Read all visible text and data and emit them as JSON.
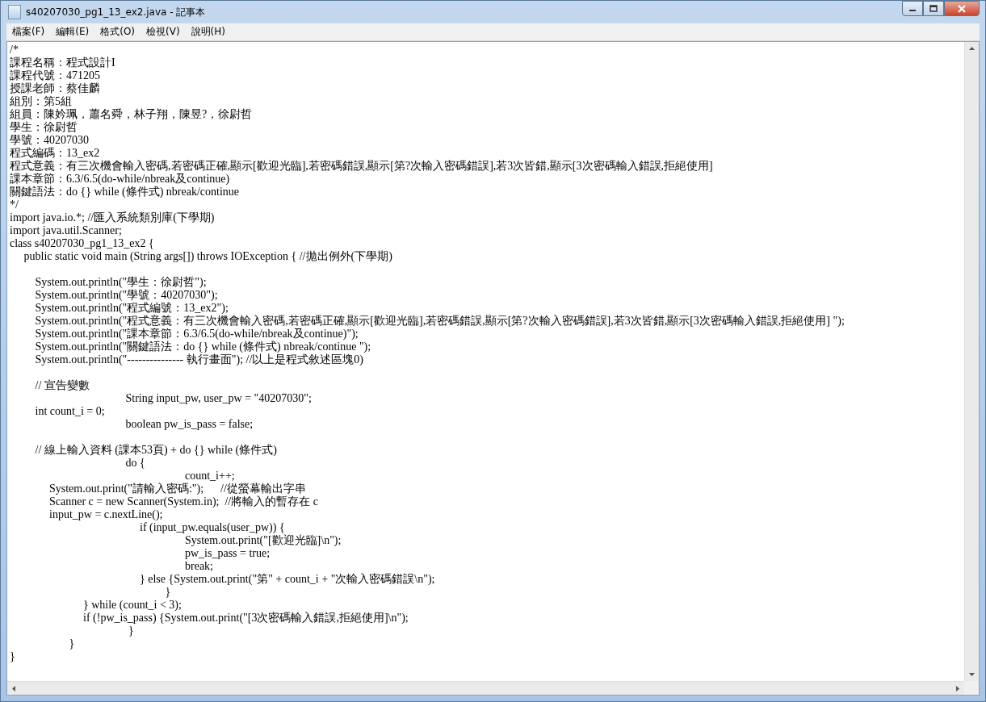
{
  "window": {
    "title": "s40207030_pg1_13_ex2.java - 記事本"
  },
  "menu": [
    {
      "label": "檔案(F)"
    },
    {
      "label": "編輯(E)"
    },
    {
      "label": "格式(O)"
    },
    {
      "label": "檢視(V)"
    },
    {
      "label": "說明(H)"
    }
  ],
  "editor": {
    "blocks": [
      [
        "/*",
        "課程名稱：程式設計I",
        "課程代號：471205",
        "授課老師：蔡佳麟",
        "組別：第5組",
        "組員：陳妗珮，蕭名舜，林子翔，陳昱?，徐尉哲",
        "學生：徐尉哲",
        "學號：40207030",
        "程式編碼：13_ex2",
        "程式意義：有三次機會輸入密碼,若密碼正確,顯示[歡迎光臨],若密碼錯誤,顯示[第?次輸入密碼錯誤],若3次皆錯,顯示[3次密碼輸入錯誤,拒絕使用]",
        "課本章節：6.3/6.5(do-while/nbreak及continue)",
        "關鍵語法：do {} while (條件式) nbreak/continue",
        "*/",
        "import java.io.*; //匯入系統類別庫(下學期)",
        "import java.util.Scanner;",
        "class s40207030_pg1_13_ex2 {",
        "     public static void main (String args[]) throws IOException { //拋出例外(下學期)"
      ],
      [
        "         System.out.println(\"學生：徐尉哲\");",
        "         System.out.println(\"學號：40207030\");",
        "         System.out.println(\"程式編號：13_ex2\");",
        "         System.out.println(\"程式意義：有三次機會輸入密碼,若密碼正確,顯示[歡迎光臨],若密碼錯誤,顯示[第?次輸入密碼錯誤],若3次皆錯,顯示[3次密碼輸入錯誤,拒絕使用] \");",
        "         System.out.println(\"課本章節：6.3/6.5(do-while/nbreak及continue)\");",
        "         System.out.println(\"關鍵語法：do {} while (條件式) nbreak/continue \");",
        "         System.out.println(\"--------------- 執行畫面\"); //以上是程式敘述區塊0)"
      ],
      [
        "         // 宣告變數",
        "                                         String input_pw, user_pw = \"40207030\";",
        "         int count_i = 0;",
        "                                         boolean pw_is_pass = false;"
      ],
      [
        "         // 線上輸入資料 (課本53頁) + do {} while (條件式)",
        "                                         do {",
        "                                                              count_i++;",
        "              System.out.print(\"請輸入密碼:\");      //從螢幕輸出字串",
        "              Scanner c = new Scanner(System.in);  //將輸入的暫存在 c",
        "              input_pw = c.nextLine();",
        "                                              if (input_pw.equals(user_pw)) {",
        "                                                              System.out.print(\"[歡迎光臨]\\n\");",
        "                                                              pw_is_pass = true;",
        "                                                              break;",
        "                                              } else {System.out.print(\"第\" + count_i + \"次輸入密碼錯誤\\n\");",
        "                                                       }",
        "                          } while (count_i < 3);",
        "                          if (!pw_is_pass) {System.out.print(\"[3次密碼輸入錯誤,拒絕使用]\\n\");",
        "                                          }",
        "                     }",
        "}"
      ]
    ]
  }
}
